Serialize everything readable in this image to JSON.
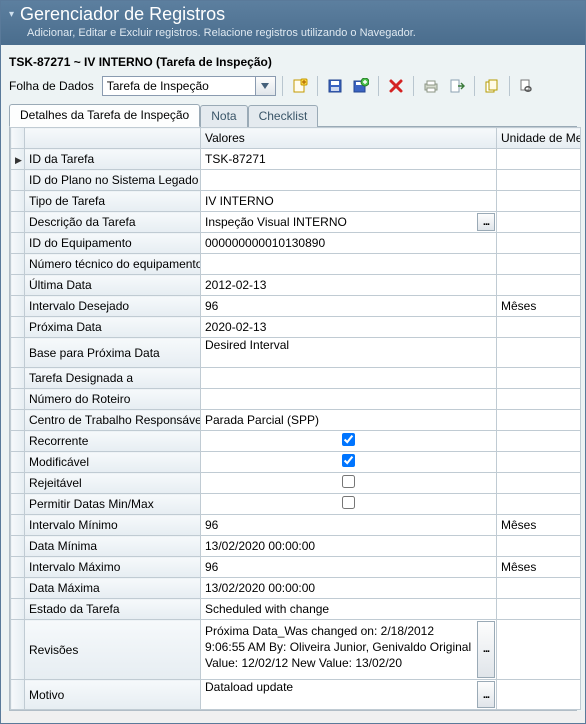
{
  "titlebar": {
    "title": "Gerenciador de Registros",
    "subtitle": "Adicionar, Editar e Excluir registros. Relacione registros utilizando o Navegador."
  },
  "record": {
    "heading": "TSK-87271 ~ IV INTERNO (Tarefa de Inspeção)"
  },
  "toolbar": {
    "sheet_label": "Folha de Dados",
    "sheet_value": "Tarefa de Inspeção"
  },
  "tabs": {
    "details": "Detalhes da Tarefa de Inspeção",
    "note": "Nota",
    "checklist": "Checklist"
  },
  "columns": {
    "values": "Valores",
    "unit": "Unidade de Me"
  },
  "units": {
    "months": "Mêses"
  },
  "rows": [
    {
      "label": "ID da Tarefa",
      "value": "TSK-87271",
      "unit": "",
      "check": null,
      "current": true
    },
    {
      "label": "ID do Plano no Sistema Legado",
      "value": "",
      "unit": "",
      "check": null
    },
    {
      "label": "Tipo de Tarefa",
      "value": "IV INTERNO",
      "unit": "",
      "check": null
    },
    {
      "label": "Descrição da Tarefa",
      "value": "Inspeção Visual INTERNO",
      "unit": "",
      "check": null,
      "ellipsis": true
    },
    {
      "label": "ID do Equipamento",
      "value": "000000000010130890",
      "unit": "",
      "check": null
    },
    {
      "label": "Número técnico do equipamento",
      "value": "",
      "unit": "",
      "check": null
    },
    {
      "label": "Última Data",
      "value": "2012-02-13",
      "unit": "",
      "check": null
    },
    {
      "label": "Intervalo Desejado",
      "value": "96",
      "unit": "Mêses",
      "check": null
    },
    {
      "label": "Próxima Data",
      "value": "2020-02-13",
      "unit": "",
      "check": null
    },
    {
      "label": "Base para Próxima Data",
      "value": "Desired Interval",
      "unit": "",
      "check": null,
      "tall": true
    },
    {
      "label": "Tarefa Designada a",
      "value": "",
      "unit": "",
      "check": null
    },
    {
      "label": "Número do Roteiro",
      "value": "",
      "unit": "",
      "check": null
    },
    {
      "label": "Centro de Trabalho Responsável",
      "value": "Parada Parcial (SPP)",
      "unit": "",
      "check": null
    },
    {
      "label": "Recorrente",
      "value": "",
      "unit": "",
      "check": true
    },
    {
      "label": "Modificável",
      "value": "",
      "unit": "",
      "check": true
    },
    {
      "label": "Rejeitável",
      "value": "",
      "unit": "",
      "check": false
    },
    {
      "label": "Permitir Datas Min/Max",
      "value": "",
      "unit": "",
      "check": false
    },
    {
      "label": "Intervalo Mínimo",
      "value": "96",
      "unit": "Mêses",
      "check": null
    },
    {
      "label": "Data Mínima",
      "value": "13/02/2020 00:00:00",
      "unit": "",
      "check": null
    },
    {
      "label": "Intervalo Máximo",
      "value": "96",
      "unit": "Mêses",
      "check": null
    },
    {
      "label": "Data Máxima",
      "value": "13/02/2020 00:00:00",
      "unit": "",
      "check": null
    },
    {
      "label": "Estado da Tarefa",
      "value": "Scheduled with change",
      "unit": "",
      "check": null
    },
    {
      "label": "Revisões",
      "value": "Próxima Data_Was changed on: 2/18/2012 9:06:55 AM\n  By: Oliveira Junior, Genivaldo\n  Original Value: 12/02/12\n  New Value: 13/02/20",
      "unit": "",
      "check": null,
      "multi": true,
      "ellipsis": true
    },
    {
      "label": "Motivo",
      "value": "Dataload update",
      "unit": "",
      "check": null,
      "tall": true,
      "ellipsis": true
    }
  ]
}
